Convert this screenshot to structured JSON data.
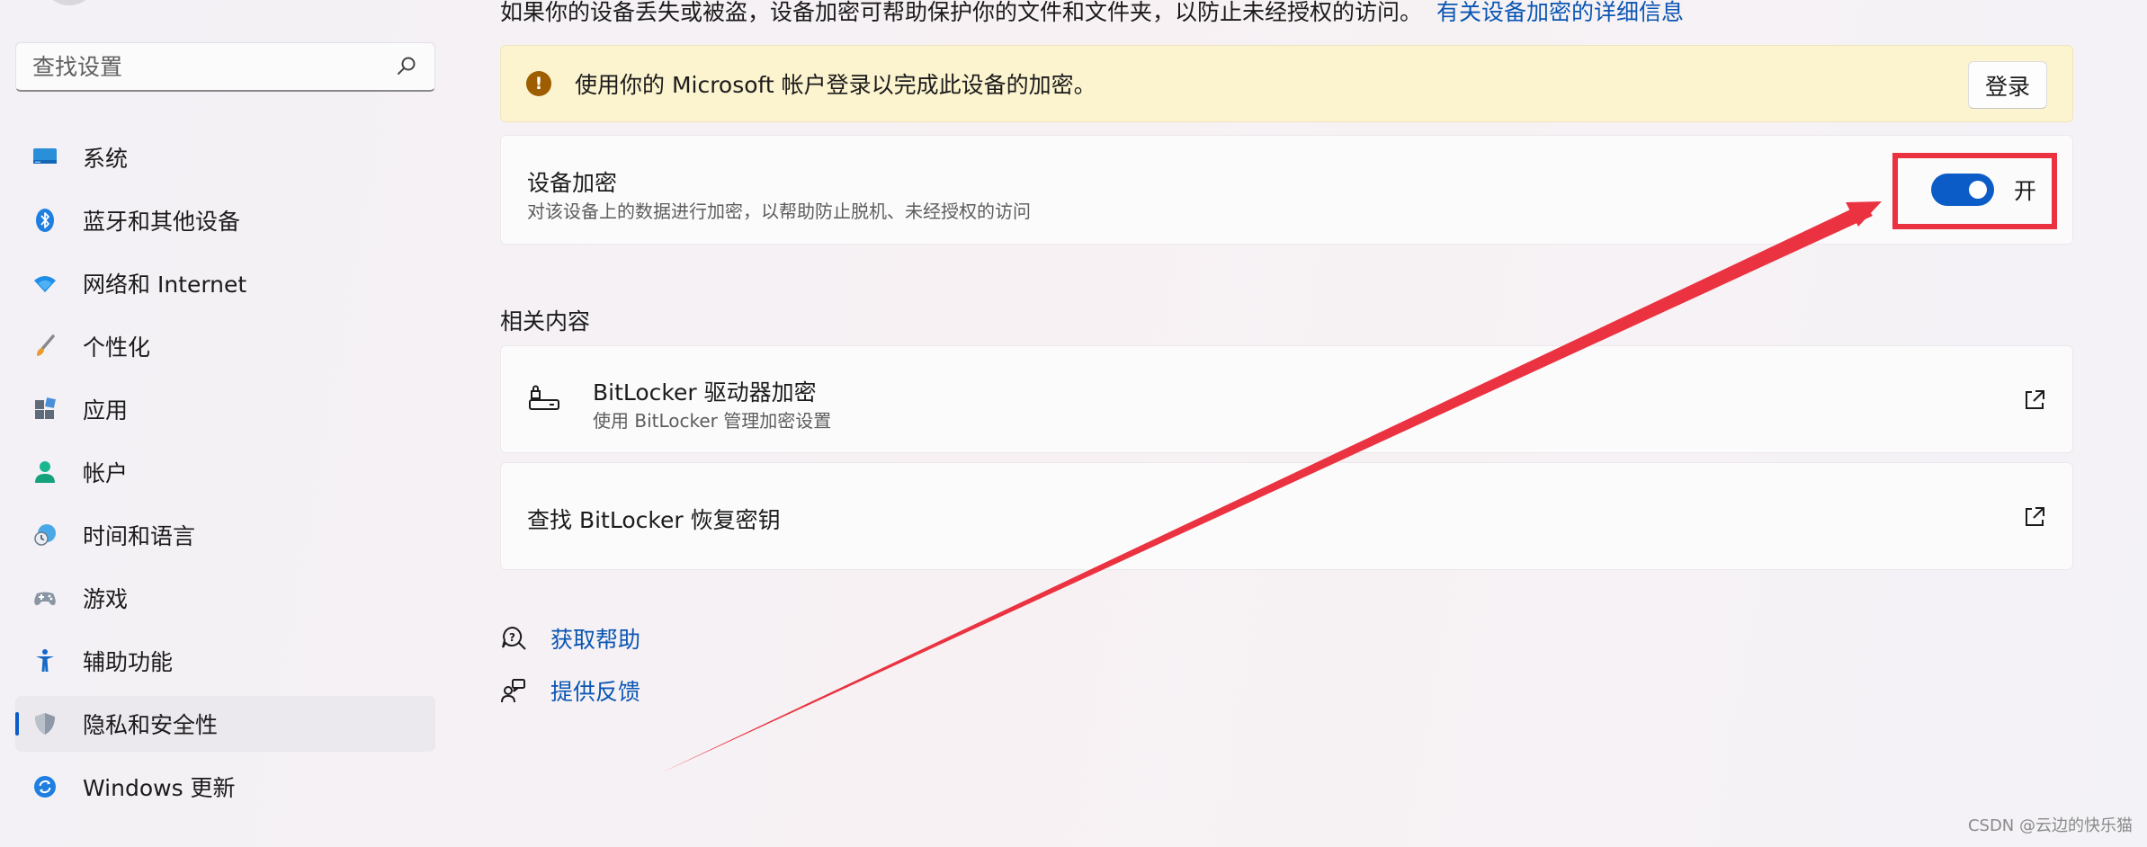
{
  "sidebar": {
    "search_placeholder": "查找设置",
    "items": [
      {
        "label": "系统",
        "icon": "monitor-icon"
      },
      {
        "label": "蓝牙和其他设备",
        "icon": "bluetooth-icon"
      },
      {
        "label": "网络和 Internet",
        "icon": "wifi-icon"
      },
      {
        "label": "个性化",
        "icon": "brush-icon"
      },
      {
        "label": "应用",
        "icon": "apps-icon"
      },
      {
        "label": "帐户",
        "icon": "person-icon"
      },
      {
        "label": "时间和语言",
        "icon": "globe-clock-icon"
      },
      {
        "label": "游戏",
        "icon": "gamepad-icon"
      },
      {
        "label": "辅助功能",
        "icon": "accessibility-icon"
      },
      {
        "label": "隐私和安全性",
        "icon": "shield-icon",
        "active": true
      },
      {
        "label": "Windows 更新",
        "icon": "refresh-icon"
      }
    ]
  },
  "main": {
    "intro_text": "如果你的设备丢失或被盗，设备加密可帮助保护你的文件和文件夹，以防止未经授权的访问。",
    "intro_link": "有关设备加密的详细信息",
    "banner": {
      "text": "使用你的 Microsoft 帐户登录以完成此设备的加密。",
      "button_label": "登录"
    },
    "device_encryption": {
      "title": "设备加密",
      "subtitle": "对该设备上的数据进行加密，以帮助防止脱机、未经授权的访问",
      "toggle_label": "开",
      "toggle_on": true
    },
    "related": {
      "heading": "相关内容",
      "items": [
        {
          "title": "BitLocker 驱动器加密",
          "subtitle": "使用 BitLocker 管理加密设置"
        },
        {
          "title": "查找 BitLocker 恢复密钥",
          "subtitle": ""
        }
      ]
    },
    "help": {
      "get_help": "获取帮助",
      "feedback": "提供反馈"
    }
  },
  "annotation_color": "#ea3240",
  "accent_color": "#0b5cc7",
  "watermark": "CSDN @云边的快乐猫"
}
